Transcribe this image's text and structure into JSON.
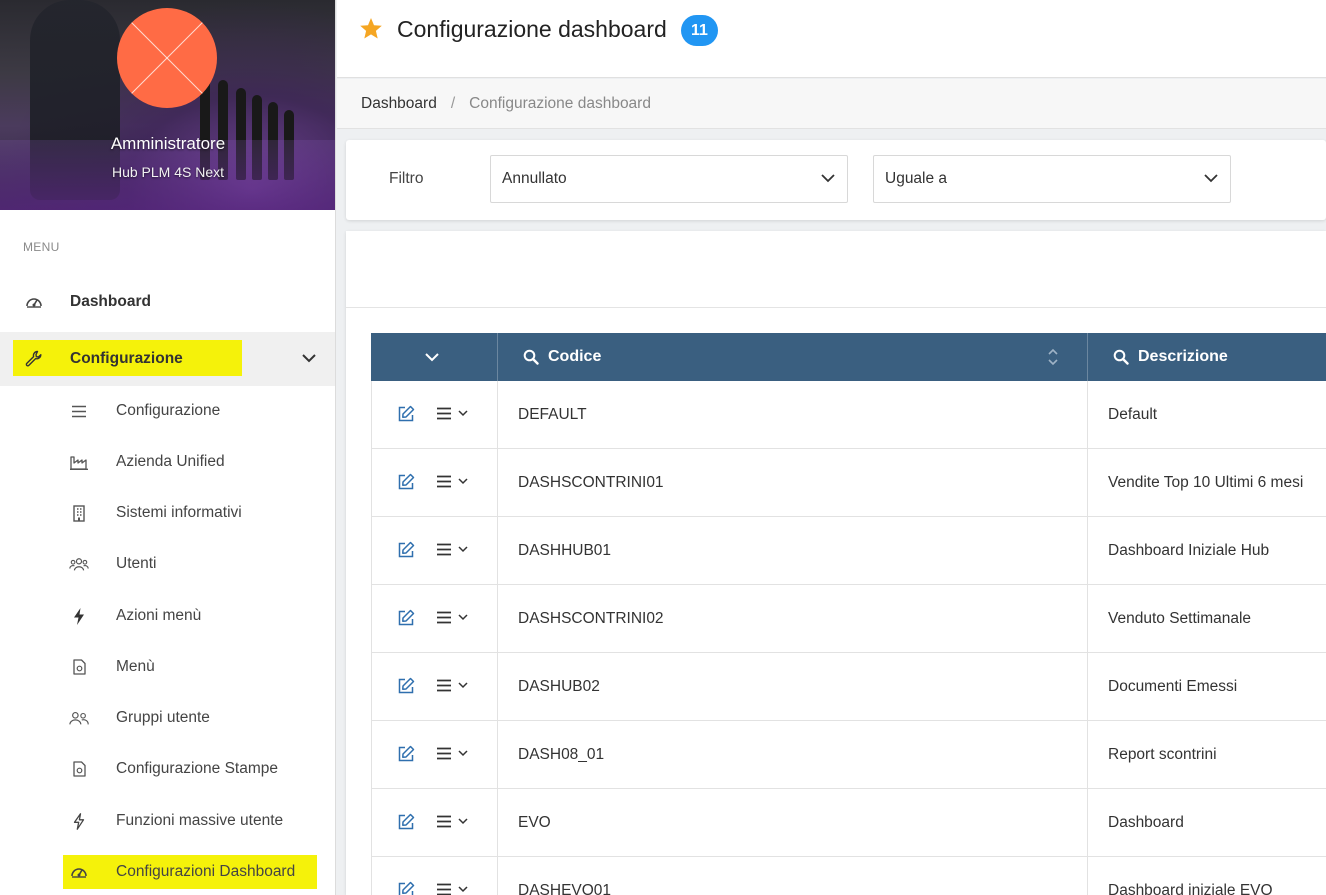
{
  "profile": {
    "name": "Amministratore",
    "subtitle": "Hub PLM 4S Next"
  },
  "sidebar": {
    "menu_title": "MENU",
    "items": [
      {
        "label": "Dashboard",
        "icon": "speedometer-icon"
      },
      {
        "label": "Configurazione",
        "icon": "wrench-icon",
        "expanded": true
      }
    ],
    "sub_items": [
      {
        "label": "Configurazione",
        "icon": "list-icon"
      },
      {
        "label": "Azienda Unified",
        "icon": "factory-icon"
      },
      {
        "label": "Sistemi informativi",
        "icon": "building-icon"
      },
      {
        "label": "Utenti",
        "icon": "users-icon"
      },
      {
        "label": "Azioni menù",
        "icon": "lightning-icon"
      },
      {
        "label": "Menù",
        "icon": "file-icon"
      },
      {
        "label": "Gruppi utente",
        "icon": "user-group-icon"
      },
      {
        "label": "Configurazione Stampe",
        "icon": "file-icon"
      },
      {
        "label": "Funzioni massive utente",
        "icon": "lightning-outline-icon"
      },
      {
        "label": "Configurazioni Dashboard",
        "icon": "speedometer-icon"
      }
    ]
  },
  "header": {
    "title": "Configurazione dashboard",
    "count": "11",
    "star_color": "#f5a623",
    "badge_color": "#2196f3"
  },
  "breadcrumb": {
    "home": "Dashboard",
    "separator": "/",
    "current": "Configurazione dashboard"
  },
  "filter": {
    "label": "Filtro",
    "field_value": "Annullato",
    "operator_value": "Uguale a"
  },
  "table": {
    "header_color": "#3a5f80",
    "columns": [
      {
        "label": "Codice"
      },
      {
        "label": "Descrizione"
      }
    ],
    "rows": [
      {
        "code": "DEFAULT",
        "description": "Default"
      },
      {
        "code": "DASHSCONTRINI01",
        "description": "Vendite Top 10 Ultimi 6 mesi"
      },
      {
        "code": "DASHHUB01",
        "description": "Dashboard Iniziale Hub"
      },
      {
        "code": "DASHSCONTRINI02",
        "description": "Venduto Settimanale"
      },
      {
        "code": "DASHUB02",
        "description": "Documenti Emessi"
      },
      {
        "code": "DASH08_01",
        "description": "Report scontrini"
      },
      {
        "code": "EVO",
        "description": "Dashboard"
      },
      {
        "code": "DASHEVO01",
        "description": "Dashboard iniziale EVO"
      }
    ]
  }
}
